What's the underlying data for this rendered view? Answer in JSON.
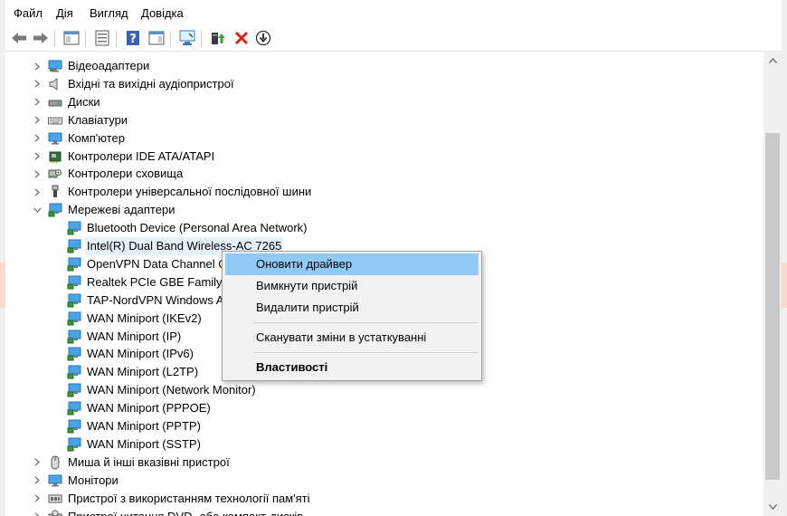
{
  "menu": [
    "Файл",
    "Дія",
    "Вигляд",
    "Довідка"
  ],
  "toolbar": {
    "buttons": [
      {
        "name": "back-arrow-icon"
      },
      {
        "name": "forward-arrow-icon"
      },
      {
        "name": "show-hide-console-tree-icon"
      },
      {
        "name": "properties-icon"
      },
      {
        "name": "help-icon"
      },
      {
        "name": "action-pane-icon"
      },
      {
        "name": "scan-hardware-icon"
      },
      {
        "name": "update-driver-icon"
      },
      {
        "name": "uninstall-device-icon"
      },
      {
        "name": "disable-device-icon"
      }
    ]
  },
  "tree": {
    "items": [
      {
        "label": "Відеоадаптери",
        "icon": "display-adapter-icon",
        "level": 0,
        "expander": "collapsed"
      },
      {
        "label": "Вхідні та вихідні аудіопристрої",
        "icon": "speaker-icon",
        "level": 0,
        "expander": "collapsed"
      },
      {
        "label": "Диски",
        "icon": "disk-drive-icon",
        "level": 0,
        "expander": "collapsed"
      },
      {
        "label": "Клавіатури",
        "icon": "keyboard-icon",
        "level": 0,
        "expander": "collapsed"
      },
      {
        "label": "Комп'ютер",
        "icon": "computer-icon",
        "level": 0,
        "expander": "collapsed"
      },
      {
        "label": "Контролери IDE ATA/ATAPI",
        "icon": "ide-controller-icon",
        "level": 0,
        "expander": "collapsed"
      },
      {
        "label": "Контролери сховища",
        "icon": "storage-controller-icon",
        "level": 0,
        "expander": "collapsed"
      },
      {
        "label": "Контролери універсальної послідовної шини",
        "icon": "usb-icon",
        "level": 0,
        "expander": "collapsed"
      },
      {
        "label": "Мережеві адаптери",
        "icon": "network-adapter-icon",
        "level": 0,
        "expander": "expanded"
      },
      {
        "label": "Bluetooth Device (Personal Area Network)",
        "icon": "network-adapter-icon",
        "level": 1
      },
      {
        "label": "Intel(R) Dual Band Wireless-AC 7265",
        "icon": "network-adapter-icon",
        "level": 1,
        "selected": true
      },
      {
        "label": "OpenVPN Data Channel Offload",
        "icon": "network-adapter-icon",
        "level": 1
      },
      {
        "label": "Realtek PCIe GBE Family Controller",
        "icon": "network-adapter-icon",
        "level": 1
      },
      {
        "label": "TAP-NordVPN Windows Adapter V9",
        "icon": "network-adapter-icon",
        "level": 1
      },
      {
        "label": "WAN Miniport (IKEv2)",
        "icon": "network-adapter-icon",
        "level": 1
      },
      {
        "label": "WAN Miniport (IP)",
        "icon": "network-adapter-icon",
        "level": 1
      },
      {
        "label": "WAN Miniport (IPv6)",
        "icon": "network-adapter-icon",
        "level": 1
      },
      {
        "label": "WAN Miniport (L2TP)",
        "icon": "network-adapter-icon",
        "level": 1
      },
      {
        "label": "WAN Miniport (Network Monitor)",
        "icon": "network-adapter-icon",
        "level": 1
      },
      {
        "label": "WAN Miniport (PPPOE)",
        "icon": "network-adapter-icon",
        "level": 1
      },
      {
        "label": "WAN Miniport (PPTP)",
        "icon": "network-adapter-icon",
        "level": 1
      },
      {
        "label": "WAN Miniport (SSTP)",
        "icon": "network-adapter-icon",
        "level": 1
      },
      {
        "label": "Миша й інші вказівні пристрої",
        "icon": "mouse-icon",
        "level": 0,
        "expander": "collapsed"
      },
      {
        "label": "Монітори",
        "icon": "monitor-icon",
        "level": 0,
        "expander": "collapsed"
      },
      {
        "label": "Пристрої з використанням технології пам'яті",
        "icon": "memory-device-icon",
        "level": 0,
        "expander": "collapsed"
      },
      {
        "label": "Пристрої читання DVD- або компакт-дисків",
        "icon": "dvd-drive-icon",
        "level": 0,
        "expander": "collapsed"
      }
    ]
  },
  "context_menu": {
    "items": [
      {
        "label": "Оновити драйвер",
        "highlight": true
      },
      {
        "label": "Вимкнути пристрій"
      },
      {
        "label": "Видалити пристрій"
      },
      {
        "separator": true
      },
      {
        "label": "Сканувати зміни в устаткуванні"
      },
      {
        "separator": true
      },
      {
        "label": "Властивості",
        "bold": true
      }
    ]
  },
  "colors": {
    "selection": "#e5f1fb",
    "menu_highlight": "#91c9f7",
    "icon_blue": "#2f8fd8",
    "icon_green": "#3aa23a",
    "delete_red": "#e0201b"
  }
}
